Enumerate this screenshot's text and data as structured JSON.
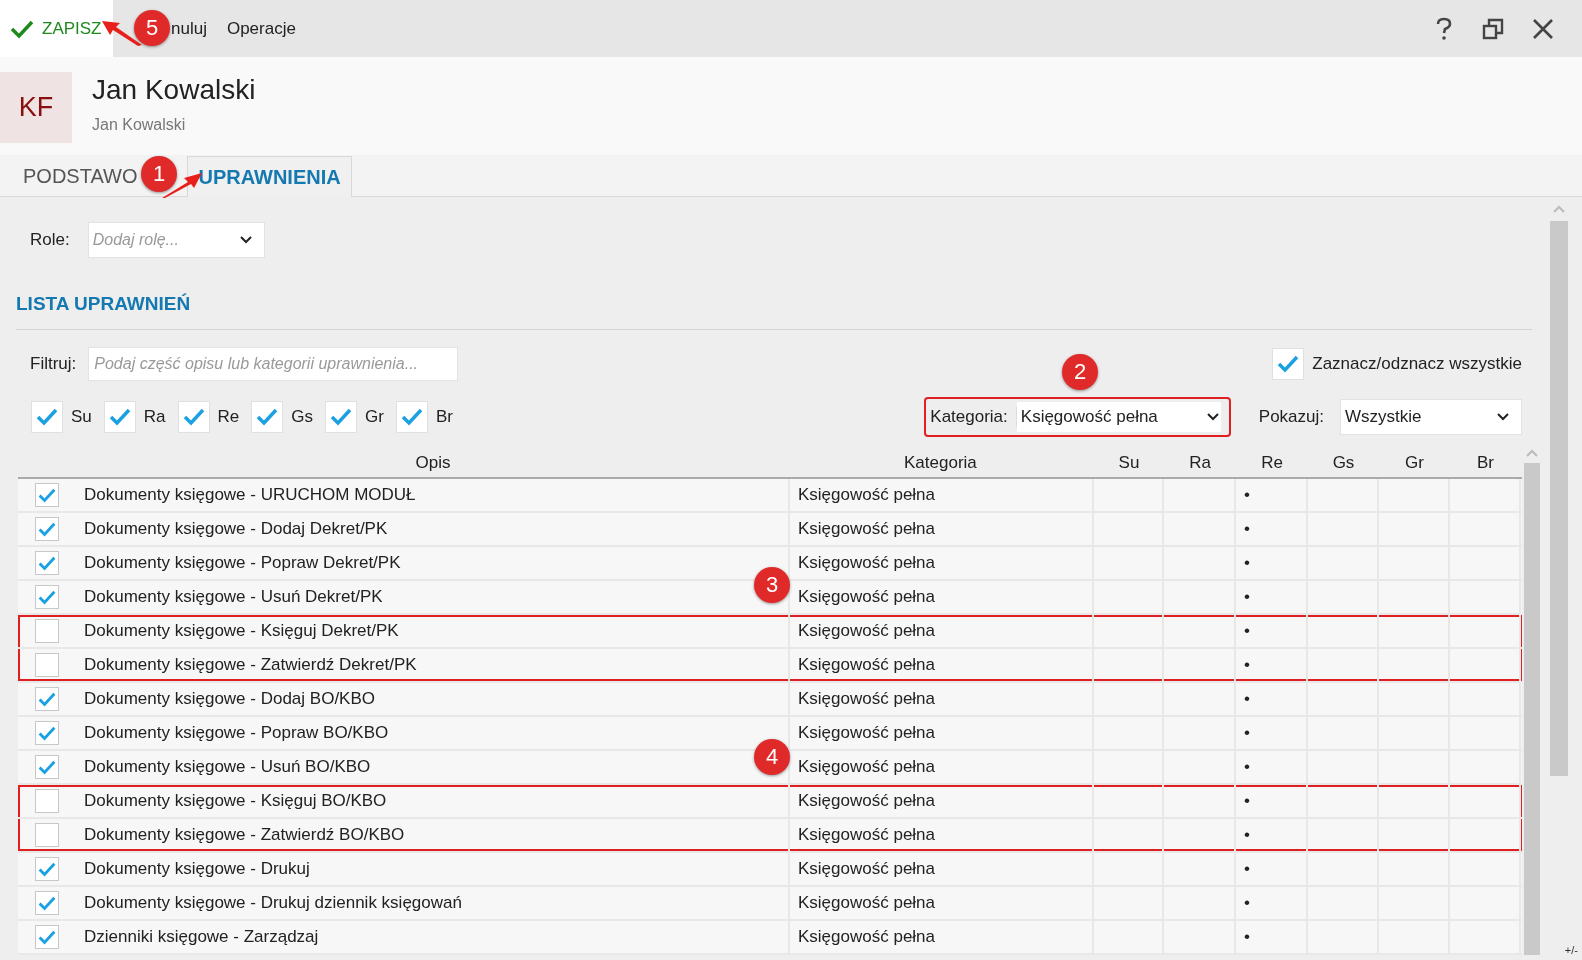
{
  "toolbar": {
    "save": "ZAPISZ",
    "cancel": "nuluj",
    "operations": "Operacje"
  },
  "header": {
    "initials": "KF",
    "name": "Jan Kowalski",
    "subtitle": "Jan Kowalski"
  },
  "tabs": [
    {
      "label": "PODSTAWO",
      "selected": false
    },
    {
      "label": "UPRAWNIENIA",
      "selected": true
    }
  ],
  "roles": {
    "label": "Role:",
    "placeholder": "Dodaj rolę..."
  },
  "section_title": "LISTA UPRAWNIEŃ",
  "filter": {
    "label": "Filtruj:",
    "placeholder": "Podaj część opisu lub kategorii uprawnienia..."
  },
  "select_all": {
    "label": "Zaznacz/odznacz wszystkie",
    "checked": true
  },
  "flag_filters": [
    {
      "label": "Su",
      "checked": true
    },
    {
      "label": "Ra",
      "checked": true
    },
    {
      "label": "Re",
      "checked": true
    },
    {
      "label": "Gs",
      "checked": true
    },
    {
      "label": "Gr",
      "checked": true
    },
    {
      "label": "Br",
      "checked": true
    }
  ],
  "category_filter": {
    "label": "Kategoria:",
    "value": "Księgowość pełna",
    "highlighted": true
  },
  "show_filter": {
    "label": "Pokazuj:",
    "value": "Wszystkie"
  },
  "table": {
    "columns": [
      "Opis",
      "Kategoria",
      "Su",
      "Ra",
      "Re",
      "Gs",
      "Gr",
      "Br"
    ],
    "rows": [
      {
        "checked": true,
        "opis": "Dokumenty księgowe - URUCHOM MODUŁ",
        "kategoria": "Księgowość pełna",
        "re": "•",
        "highlighted": false
      },
      {
        "checked": true,
        "opis": "Dokumenty księgowe - Dodaj Dekret/PK",
        "kategoria": "Księgowość pełna",
        "re": "•",
        "highlighted": false
      },
      {
        "checked": true,
        "opis": "Dokumenty księgowe - Popraw Dekret/PK",
        "kategoria": "Księgowość pełna",
        "re": "•",
        "highlighted": false
      },
      {
        "checked": true,
        "opis": "Dokumenty księgowe - Usuń Dekret/PK",
        "kategoria": "Księgowość pełna",
        "re": "•",
        "highlighted": false
      },
      {
        "checked": false,
        "opis": "Dokumenty księgowe - Księguj Dekret/PK",
        "kategoria": "Księgowość pełna",
        "re": "•",
        "highlighted": true
      },
      {
        "checked": false,
        "opis": "Dokumenty księgowe - Zatwierdź Dekret/PK",
        "kategoria": "Księgowość pełna",
        "re": "•",
        "highlighted": true
      },
      {
        "checked": true,
        "opis": "Dokumenty księgowe - Dodaj BO/KBO",
        "kategoria": "Księgowość pełna",
        "re": "•",
        "highlighted": false
      },
      {
        "checked": true,
        "opis": "Dokumenty księgowe - Popraw BO/KBO",
        "kategoria": "Księgowość pełna",
        "re": "•",
        "highlighted": false
      },
      {
        "checked": true,
        "opis": "Dokumenty księgowe - Usuń BO/KBO",
        "kategoria": "Księgowość pełna",
        "re": "•",
        "highlighted": false
      },
      {
        "checked": false,
        "opis": "Dokumenty księgowe - Księguj BO/KBO",
        "kategoria": "Księgowość pełna",
        "re": "•",
        "highlighted": true
      },
      {
        "checked": false,
        "opis": "Dokumenty księgowe - Zatwierdź BO/KBO",
        "kategoria": "Księgowość pełna",
        "re": "•",
        "highlighted": true
      },
      {
        "checked": true,
        "opis": "Dokumenty księgowe - Drukuj",
        "kategoria": "Księgowość pełna",
        "re": "•",
        "highlighted": false
      },
      {
        "checked": true,
        "opis": "Dokumenty księgowe - Drukuj dziennik księgowań",
        "kategoria": "Księgowość pełna",
        "re": "•",
        "highlighted": false
      },
      {
        "checked": true,
        "opis": "Dzienniki księgowe - Zarządzaj",
        "kategoria": "Księgowość pełna",
        "re": "•",
        "highlighted": false
      }
    ]
  },
  "corner_mark": "+/-",
  "annotations": [
    {
      "label": "1",
      "arrow": true
    },
    {
      "label": "2",
      "arrow": false
    },
    {
      "label": "3",
      "arrow": false
    },
    {
      "label": "4",
      "arrow": false
    },
    {
      "label": "5",
      "arrow": true
    }
  ]
}
